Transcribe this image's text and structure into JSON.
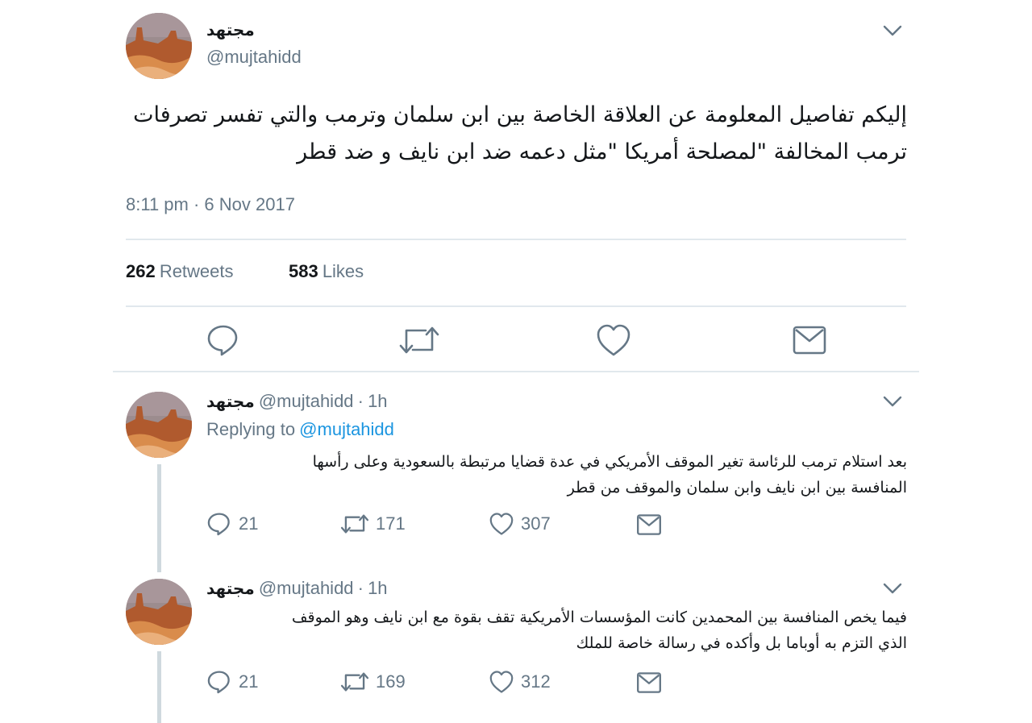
{
  "main_tweet": {
    "author_name": "مجتهد",
    "handle": "@mujtahidd",
    "text_line1": "إليكم تفاصيل المعلومة عن العلاقة الخاصة بين ابن سلمان وترمب والتي تفسر تصرفات",
    "text_line2": "ترمب المخالفة \"لمصلحة أمريكا \"مثل دعمه ضد ابن نايف و ضد قطر",
    "timestamp": "8:11 pm · 6 Nov 2017",
    "retweets_count": "262",
    "retweets_label": "Retweets",
    "likes_count": "583",
    "likes_label": "Likes"
  },
  "replies": [
    {
      "author_name": "مجتهد",
      "handle": "@mujtahidd",
      "sep": "·",
      "time": "1h",
      "replying_prefix": "Replying to",
      "replying_handle": "@mujtahidd",
      "text_line1": "بعد استلام ترمب للرئاسة تغير الموقف الأمريكي في عدة قضايا مرتبطة بالسعودية وعلى رأسها",
      "text_line2": "المنافسة بين ابن نايف وابن سلمان والموقف من قطر",
      "reply_count": "21",
      "retweet_count": "171",
      "like_count": "307"
    },
    {
      "author_name": "مجتهد",
      "handle": "@mujtahidd",
      "sep": "·",
      "time": "1h",
      "text_line1": "فيما يخص المنافسة بين المحمدين كانت المؤسسات الأمريكية تقف بقوة مع ابن نايف وهو الموقف",
      "text_line2": "الذي التزم به أوباما بل وأكده في رسالة خاصة للملك",
      "reply_count": "21",
      "retweet_count": "169",
      "like_count": "312"
    }
  ],
  "colors": {
    "text": "#14171a",
    "secondary": "#657786",
    "link": "#1b95e0",
    "divider": "#e1e8ed",
    "thread_line": "#cfd9de"
  },
  "icons": [
    "chevron-down-icon",
    "reply-icon",
    "retweet-icon",
    "like-icon",
    "dm-icon"
  ]
}
